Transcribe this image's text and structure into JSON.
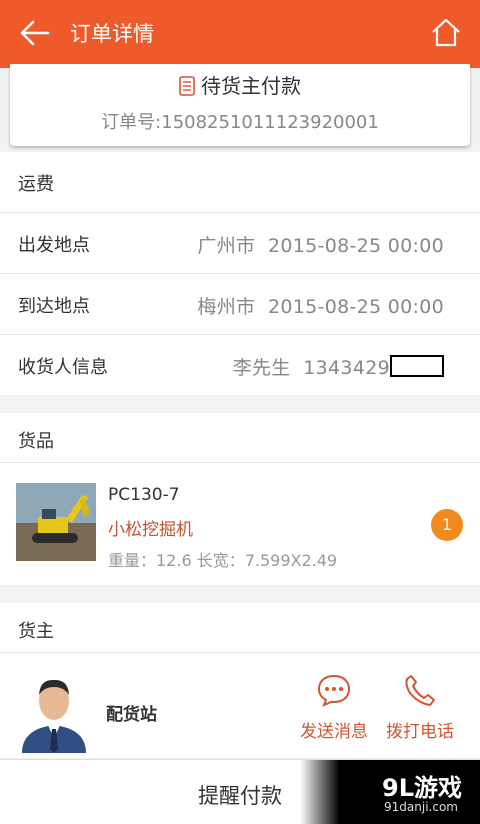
{
  "header": {
    "title": "订单详情"
  },
  "status": {
    "text": "待货主付款",
    "order_number": "订单号:1508251011123920001"
  },
  "freight": {
    "title": "运费",
    "rows": [
      {
        "label": "出发地点",
        "value": "广州市  2015-08-25 00:00"
      },
      {
        "label": "到达地点",
        "value": "梅州市  2015-08-25 00:00"
      },
      {
        "label": "收货人信息",
        "value": "李先生  1343429"
      }
    ]
  },
  "goods": {
    "title": "货品",
    "item": {
      "model": "PC130-7",
      "name": "小松挖掘机",
      "spec": "重量：12.6 长宽：7.599X2.49",
      "badge": "1"
    }
  },
  "owner": {
    "title": "货主",
    "name": "配货站",
    "actions": [
      {
        "label": "发送消息",
        "icon": "chat-icon"
      },
      {
        "label": "拨打电话",
        "icon": "phone-icon"
      }
    ]
  },
  "footer": {
    "remind_label": "提醒付款"
  },
  "watermark": {
    "main": "9L游戏",
    "sub": "91danji.com"
  },
  "colors": {
    "accent": "#ee5a2a",
    "badge": "#f08a1e"
  }
}
